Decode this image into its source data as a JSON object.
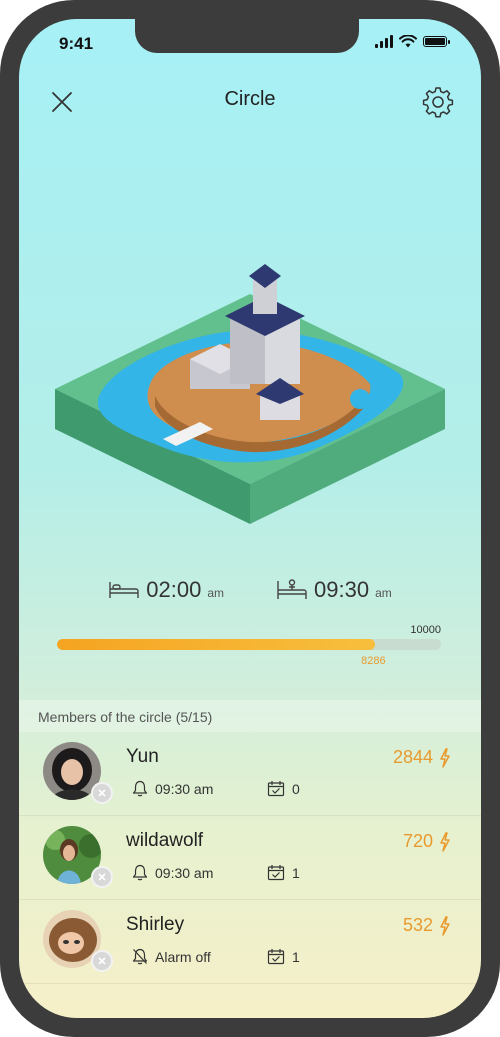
{
  "status_bar": {
    "time": "9:41"
  },
  "header": {
    "title": "Circle"
  },
  "sleep": {
    "bed_time": "02:00",
    "bed_ampm": "am",
    "wake_time": "09:30",
    "wake_ampm": "am"
  },
  "progress": {
    "target": "10000",
    "current": "8286",
    "fraction": 0.8286
  },
  "members": {
    "title": "Members of the circle (5/15)",
    "items": [
      {
        "name": "Yun",
        "alarm": "09:30 am",
        "alarm_icon": "bell-icon",
        "count": "0",
        "score": "2844"
      },
      {
        "name": "wildawolf",
        "alarm": "09:30 am",
        "alarm_icon": "bell-icon",
        "count": "1",
        "score": "720"
      },
      {
        "name": "Shirley",
        "alarm": "Alarm off",
        "alarm_icon": "bell-off-icon",
        "count": "1",
        "score": "532"
      }
    ]
  },
  "colors": {
    "accent": "#e89a2e",
    "progress": "#f5a421"
  }
}
